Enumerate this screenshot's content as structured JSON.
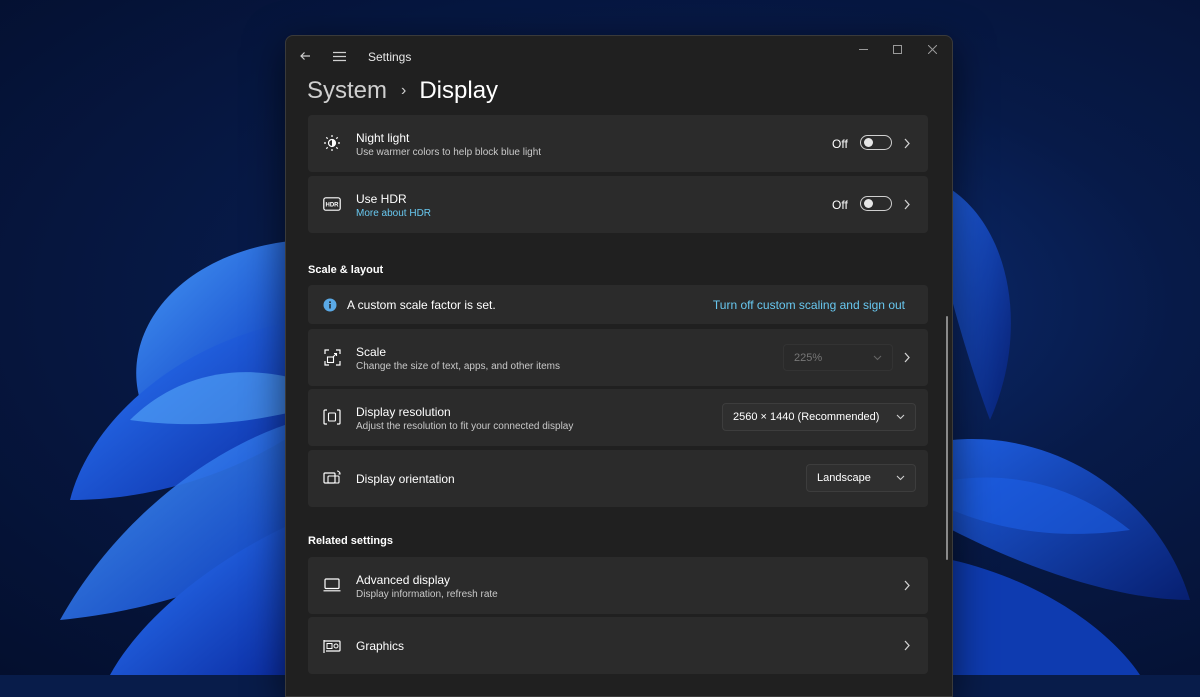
{
  "window": {
    "app_title": "Settings"
  },
  "breadcrumb": {
    "parent": "System",
    "separator": "›",
    "current": "Display"
  },
  "rows": {
    "night_light": {
      "title": "Night light",
      "subtitle": "Use warmer colors to help block blue light",
      "toggle_state": "Off",
      "icon": "brightness-icon"
    },
    "hdr": {
      "title": "Use HDR",
      "link": "More about HDR",
      "toggle_state": "Off",
      "icon": "hdr-icon"
    }
  },
  "sections": {
    "scale_layout": "Scale & layout",
    "related": "Related settings"
  },
  "scale_layout": {
    "info": {
      "text": "A custom scale factor is set.",
      "action": "Turn off custom scaling and sign out"
    },
    "scale": {
      "title": "Scale",
      "subtitle": "Change the size of text, apps, and other items",
      "value": "225%"
    },
    "resolution": {
      "title": "Display resolution",
      "subtitle": "Adjust the resolution to fit your connected display",
      "value": "2560 × 1440 (Recommended)"
    },
    "orientation": {
      "title": "Display orientation",
      "value": "Landscape"
    }
  },
  "related": {
    "advanced": {
      "title": "Advanced display",
      "subtitle": "Display information, refresh rate"
    },
    "graphics": {
      "title": "Graphics"
    }
  },
  "colors": {
    "accent_link": "#68c8f0",
    "window_bg": "#202020",
    "card_bg": "#2b2b2b"
  }
}
